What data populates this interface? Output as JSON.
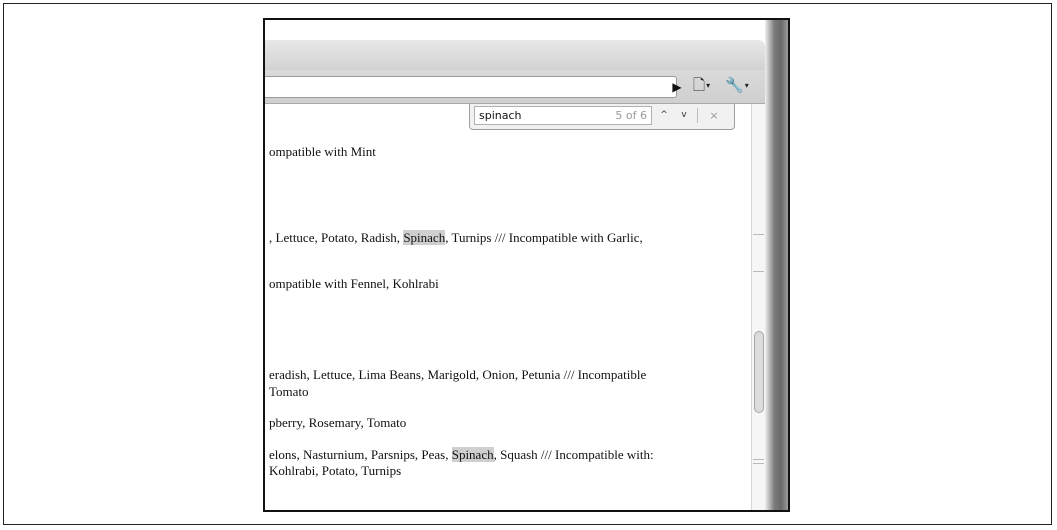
{
  "find_bar": {
    "query": "spinach",
    "count": "5 of 6",
    "up_glyph": "^",
    "down_glyph": "v",
    "close_glyph": "×"
  },
  "toolbar": {
    "go_glyph": "▶",
    "page_glyph": "🗋",
    "wrench_glyph": "🔧",
    "dropdown_glyph": "▾",
    "icons": [
      "go-icon",
      "page-menu-icon",
      "wrench-menu-icon"
    ]
  },
  "content": {
    "lines": [
      {
        "before": "ompatible with Mint",
        "match": "",
        "after": ""
      },
      {
        "before": ", Lettuce, Potato, Radish, ",
        "match": "Spinach",
        "after": ", Turnips /// Incompatible with Garlic,"
      },
      {
        "before": "ompatible with Fennel, Kohlrabi",
        "match": "",
        "after": ""
      },
      {
        "before": "eradish, Lettuce, Lima Beans, Marigold, Onion, Petunia  /// Incompatible",
        "match": "",
        "after": ""
      },
      {
        "before": "Tomato",
        "match": "",
        "after": ""
      },
      {
        "before": "pberry, Rosemary, Tomato",
        "match": "",
        "after": ""
      },
      {
        "before": "elons, Nasturnium, Parsnips, Peas, ",
        "match": "Spinach",
        "after": ", Squash  /// Incompatible with:"
      },
      {
        "before": "Kohlrabi, Potato, Turnips",
        "match": "",
        "after": ""
      }
    ]
  }
}
